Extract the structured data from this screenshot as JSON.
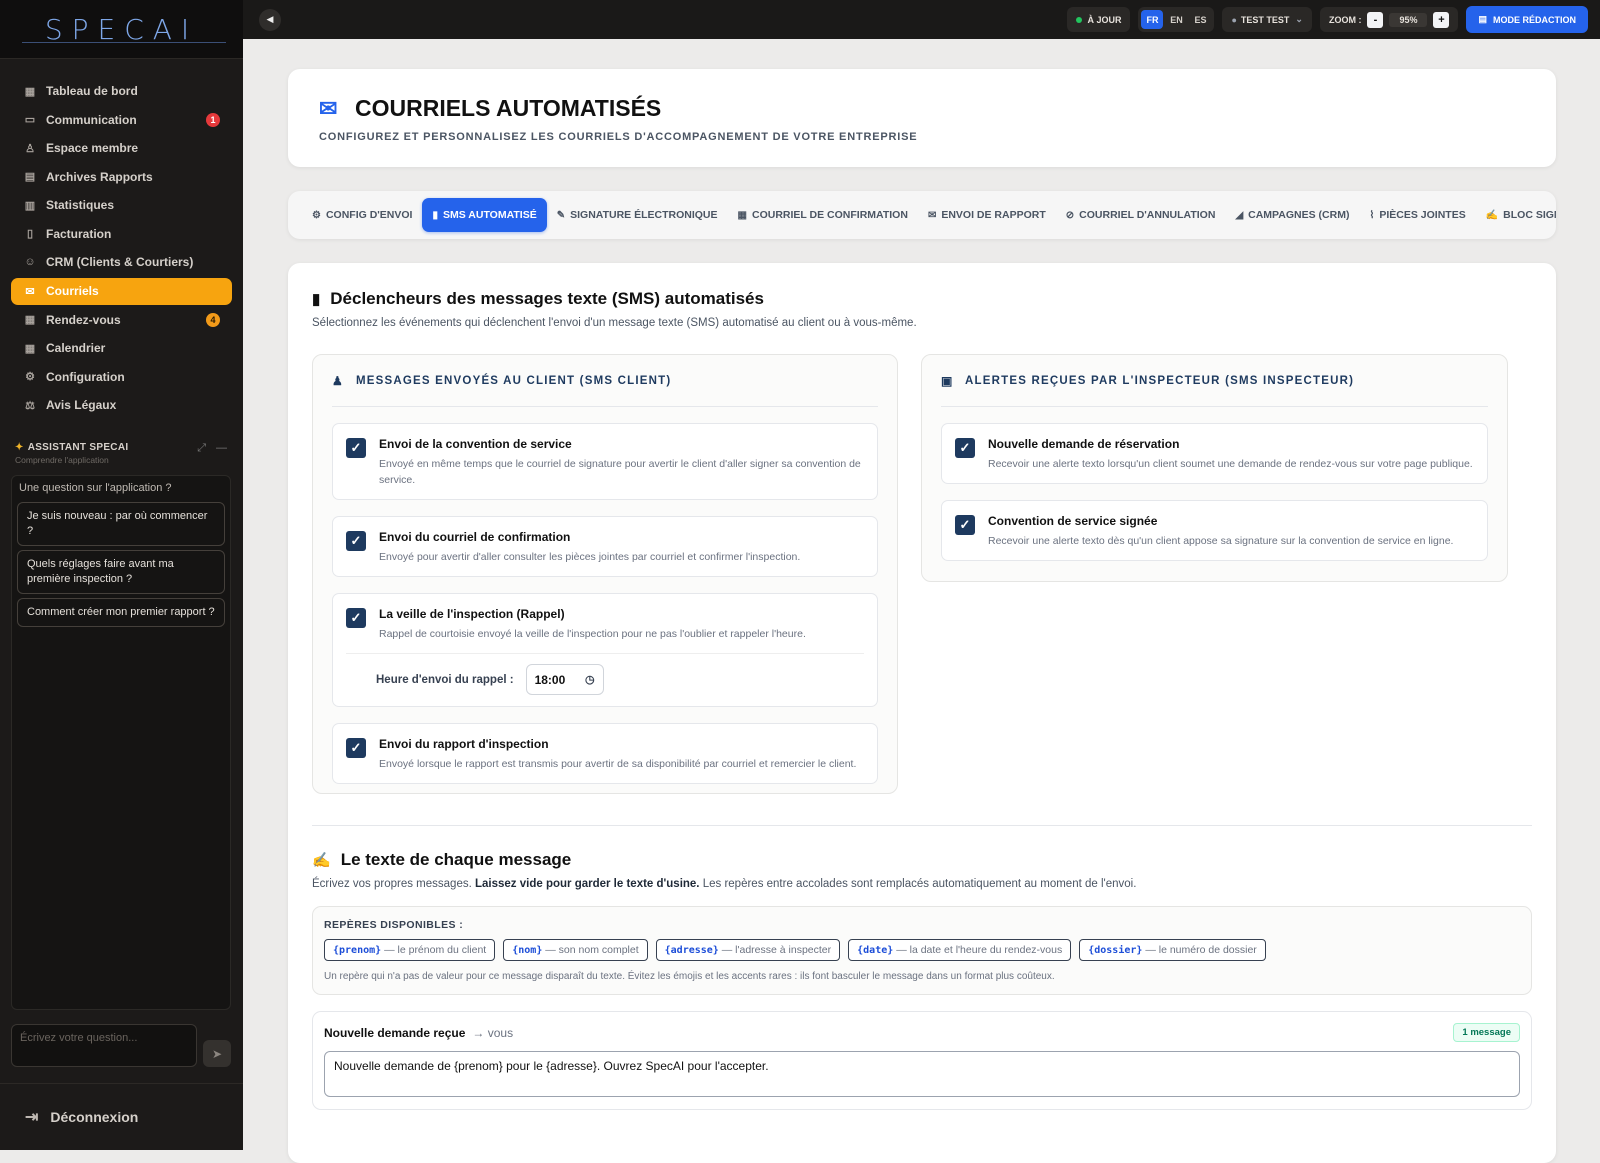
{
  "brand": {
    "logo_text": "SPECAI"
  },
  "sidebar": {
    "items": [
      {
        "label": "Tableau de bord",
        "icon": "grid-icon",
        "glyph": "▦"
      },
      {
        "label": "Communication",
        "icon": "chat-icon",
        "glyph": "▭",
        "badge": "1"
      },
      {
        "label": "Espace membre",
        "icon": "member-icon",
        "glyph": "♙"
      },
      {
        "label": "Archives Rapports",
        "icon": "archive-icon",
        "glyph": "▤"
      },
      {
        "label": "Statistiques",
        "icon": "bar-chart-icon",
        "glyph": "▥"
      },
      {
        "label": "Facturation",
        "icon": "invoice-icon",
        "glyph": "▯"
      },
      {
        "label": "CRM (Clients & Courtiers)",
        "icon": "users-icon",
        "glyph": "☺"
      },
      {
        "label": "Courriels",
        "icon": "mail-icon",
        "glyph": "✉",
        "active": true
      },
      {
        "label": "Rendez-vous",
        "icon": "calendar-icon",
        "glyph": "▦",
        "badge": "4"
      },
      {
        "label": "Calendrier",
        "icon": "calendar-alt-icon",
        "glyph": "▦"
      },
      {
        "label": "Configuration",
        "icon": "gear-icon",
        "glyph": "⚙"
      },
      {
        "label": "Avis Légaux",
        "icon": "scale-icon",
        "glyph": "⚖"
      }
    ],
    "assistant": {
      "title": "ASSISTANT SPECAI",
      "subtitle": "Comprendre l'application",
      "question": "Une question sur l'application ?",
      "suggestions": [
        "Je suis nouveau : par où commencer ?",
        "Quels réglages faire avant ma première inspection ?",
        "Comment créer mon premier rapport ?"
      ],
      "input_placeholder": "Écrivez votre question..."
    },
    "logout_label": "Déconnexion"
  },
  "topbar": {
    "status": "À JOUR",
    "langs": [
      "FR",
      "EN",
      "ES"
    ],
    "active_lang": "FR",
    "user": "TEST TEST",
    "zoom_label": "ZOOM :",
    "zoom_value": "95%",
    "mode_button": "MODE RÉDACTION"
  },
  "header": {
    "title": "COURRIELS AUTOMATISÉS",
    "subtitle": "CONFIGUREZ ET PERSONNALISEZ LES COURRIELS D'ACCOMPAGNEMENT DE VOTRE ENTREPRISE"
  },
  "tabs": [
    {
      "label": "CONFIG D'ENVOI",
      "glyph": "⚙"
    },
    {
      "label": "SMS AUTOMATISÉ",
      "glyph": "▮",
      "active": true
    },
    {
      "label": "SIGNATURE ÉLECTRONIQUE",
      "glyph": "✎"
    },
    {
      "label": "COURRIEL DE CONFIRMATION",
      "glyph": "▦"
    },
    {
      "label": "ENVOI DE RAPPORT",
      "glyph": "✉"
    },
    {
      "label": "COURRIEL D'ANNULATION",
      "glyph": "⊘"
    },
    {
      "label": "CAMPAGNES (CRM)",
      "glyph": "◢"
    },
    {
      "label": "PIÈCES JOINTES",
      "glyph": "⌇"
    },
    {
      "label": "BLOC SIGNA",
      "glyph": "✍"
    }
  ],
  "triggers": {
    "title": "Déclencheurs des messages texte (SMS) automatisés",
    "description": "Sélectionnez les événements qui déclenchent l'envoi d'un message texte (SMS) automatisé au client ou à vous-même.",
    "client": {
      "heading": "MESSAGES ENVOYÉS AU CLIENT (SMS CLIENT)",
      "options": [
        {
          "title": "Envoi de la convention de service",
          "desc": "Envoyé en même temps que le courriel de signature pour avertir le client d'aller signer sa convention de service."
        },
        {
          "title": "Envoi du courriel de confirmation",
          "desc": "Envoyé pour avertir d'aller consulter les pièces jointes par courriel et confirmer l'inspection."
        },
        {
          "title": "La veille de l'inspection (Rappel)",
          "desc": "Rappel de courtoisie envoyé la veille de l'inspection pour ne pas l'oublier et rappeler l'heure."
        },
        {
          "title": "Envoi du rapport d'inspection",
          "desc": "Envoyé lorsque le rapport est transmis pour avertir de sa disponibilité par courriel et remercier le client."
        }
      ],
      "reminder_label": "Heure d'envoi du rappel :",
      "reminder_time": "18:00"
    },
    "inspector": {
      "heading": "ALERTES REÇUES PAR L'INSPECTEUR (SMS INSPECTEUR)",
      "options": [
        {
          "title": "Nouvelle demande de réservation",
          "desc": "Recevoir une alerte texto lorsqu'un client soumet une demande de rendez-vous sur votre page publique."
        },
        {
          "title": "Convention de service signée",
          "desc": "Recevoir une alerte texto dès qu'un client appose sa signature sur la convention de service en ligne."
        }
      ]
    }
  },
  "messages": {
    "title": "Le texte de chaque message",
    "desc_start": "Écrivez vos propres messages.",
    "desc_bold": "Laissez vide pour garder le texte d'usine.",
    "desc_end": "Les repères entre accolades sont remplacés automatiquement au moment de l'envoi.",
    "tokens_heading": "REPÈRES DISPONIBLES :",
    "tokens": [
      {
        "code": "{prenom}",
        "text": "— le prénom du client"
      },
      {
        "code": "{nom}",
        "text": "— son nom complet"
      },
      {
        "code": "{adresse}",
        "text": "— l'adresse à inspecter"
      },
      {
        "code": "{date}",
        "text": "— la date et l'heure du rendez-vous"
      },
      {
        "code": "{dossier}",
        "text": "— le numéro de dossier"
      }
    ],
    "tokens_note": "Un repère qui n'a pas de valeur pour ce message disparaît du texte. Évitez les émojis et les accents rares : ils font basculer le message dans un format plus coûteux.",
    "card": {
      "title": "Nouvelle demande reçue",
      "target": "→ vous",
      "badge": "1 message",
      "text": "Nouvelle demande de {prenom} pour le {adresse}. Ouvrez SpecAI pour l'accepter."
    }
  }
}
